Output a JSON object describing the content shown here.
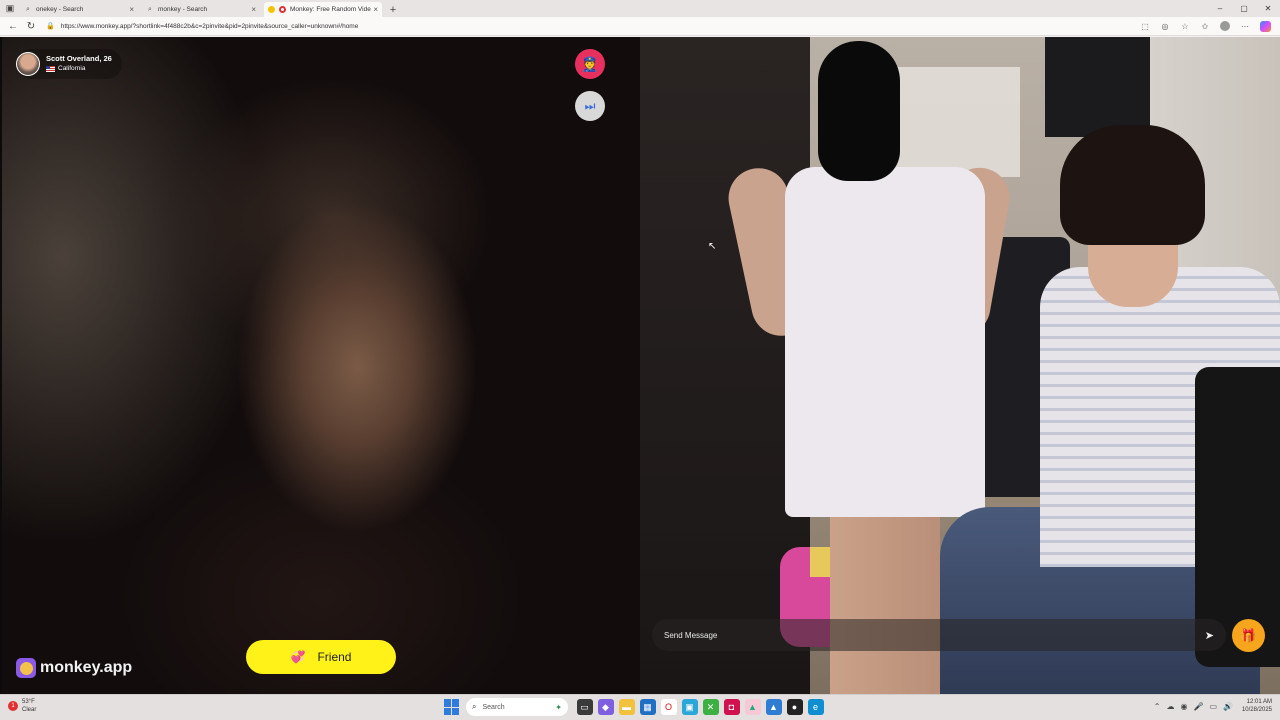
{
  "browser": {
    "tabs": [
      {
        "title": "onekey - Search",
        "icon": "search-icon"
      },
      {
        "title": "monkey - Search",
        "icon": "search-icon"
      },
      {
        "title": "Monkey: Free Random Video Chat",
        "icon": "monkey-favicon",
        "active": true
      }
    ],
    "url": "https://www.monkey.app/?shortlink=4f488c2b&c=2pinvite&pid=2pinvite&source_caller=unknown#/home"
  },
  "remote_user": {
    "name": "Scott Overland, 26",
    "location": "California",
    "flag": "us-flag-icon"
  },
  "controls": {
    "report_icon": "police-officer-icon",
    "skip_icon": "next-track-icon",
    "friend_label": "Friend",
    "message_placeholder": "Send Message",
    "gift_icon": "gift-icon"
  },
  "brand": {
    "name": "monkey.app"
  },
  "taskbar": {
    "weather_temp": "53°F",
    "weather_desc": "Clear",
    "search_placeholder": "Search",
    "time": "12:01 AM",
    "date": "10/28/2025",
    "notification_count": "1"
  },
  "colors": {
    "friend_button": "#fff219",
    "report_button": "#e8305f",
    "gift_button": "#f7a51d",
    "brand_logo": "#8a59e6"
  }
}
